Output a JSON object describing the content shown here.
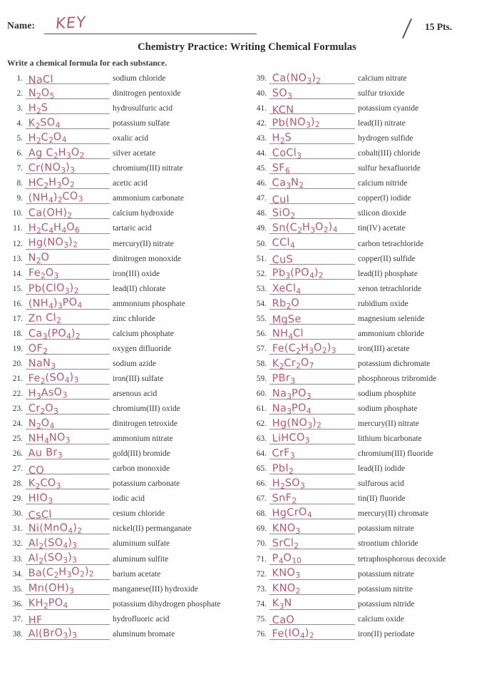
{
  "header": {
    "name_label": "Name:",
    "name_value": "KEY",
    "points": "15 Pts.",
    "score_mark": "slash-mark"
  },
  "title": "Chemistry Practice: Writing Chemical Formulas",
  "instruction": "Write a chemical formula for each substance.",
  "ink_color": "#c2566f",
  "text_color": "#3a3a3a",
  "items": [
    {
      "num": "1.",
      "formula": "NaCl",
      "name": "sodium chloride"
    },
    {
      "num": "2.",
      "formula": "N2O5",
      "name": "dinitrogen pentoxide"
    },
    {
      "num": "3.",
      "formula": "H2S",
      "name": "hydrosulfuric acid"
    },
    {
      "num": "4.",
      "formula": "K2SO4",
      "name": "potassium sulfate"
    },
    {
      "num": "5.",
      "formula": "H2C2O4",
      "name": "oxalic acid"
    },
    {
      "num": "6.",
      "formula": "Ag C2H3O2",
      "name": "silver acetate"
    },
    {
      "num": "7.",
      "formula": "Cr(NO3)3",
      "name": "chromium(III) nitrate"
    },
    {
      "num": "8.",
      "formula": "HC2H3O2",
      "name": "acetic acid"
    },
    {
      "num": "9.",
      "formula": "(NH4)2CO3",
      "name": "ammonium carbonate"
    },
    {
      "num": "10.",
      "formula": "Ca(OH)2",
      "name": "calcium hydroxide"
    },
    {
      "num": "11.",
      "formula": "H2C4H4O6",
      "name": "tartaric acid"
    },
    {
      "num": "12.",
      "formula": "Hg(NO3)2",
      "name": "mercury(II) nitrate"
    },
    {
      "num": "13.",
      "formula": "N2O",
      "name": "dinitrogen monoxide"
    },
    {
      "num": "14.",
      "formula": "Fe2O3",
      "name": "iron(III) oxide"
    },
    {
      "num": "15.",
      "formula": "Pb(ClO3)2",
      "name": "lead(II) chlorate"
    },
    {
      "num": "16.",
      "formula": "(NH4)3PO4",
      "name": "ammonium phosphate"
    },
    {
      "num": "17.",
      "formula": "Zn Cl2",
      "name": "zinc chloride"
    },
    {
      "num": "18.",
      "formula": "Ca3(PO4)2",
      "name": "calcium phosphate"
    },
    {
      "num": "19.",
      "formula": "OF2",
      "name": "oxygen difluoride"
    },
    {
      "num": "20.",
      "formula": "NaN3",
      "name": "sodium azide"
    },
    {
      "num": "21.",
      "formula": "Fe2(SO4)3",
      "name": "iron(III) sulfate"
    },
    {
      "num": "22.",
      "formula": "H3AsO3",
      "name": "arsenous acid"
    },
    {
      "num": "23.",
      "formula": "Cr2O3",
      "name": "chromium(III) oxide"
    },
    {
      "num": "24.",
      "formula": "N2O4",
      "name": "dinitrogen tetroxide"
    },
    {
      "num": "25.",
      "formula": "NH4NO3",
      "name": "ammonium nitrate"
    },
    {
      "num": "26.",
      "formula": "Au Br3",
      "name": "gold(III) bromide"
    },
    {
      "num": "27.",
      "formula": "CO",
      "name": "carbon monoxide"
    },
    {
      "num": "28.",
      "formula": "K2CO3",
      "name": "potassium carbonate"
    },
    {
      "num": "29.",
      "formula": "HIO3",
      "name": "iodic acid"
    },
    {
      "num": "30.",
      "formula": "CsCl",
      "name": "cesium chloride"
    },
    {
      "num": "31.",
      "formula": "Ni(MnO4)2",
      "name": "nickel(II) permanganate"
    },
    {
      "num": "32.",
      "formula": "Al2(SO4)3",
      "name": "aluminum sulfate"
    },
    {
      "num": "33.",
      "formula": "Al2(SO3)3",
      "name": "aluminum sulfite"
    },
    {
      "num": "34.",
      "formula": "Ba(C2H3O2)2",
      "name": "barium acetate"
    },
    {
      "num": "35.",
      "formula": "Mn(OH)3",
      "name": "manganese(III) hydroxide"
    },
    {
      "num": "36.",
      "formula": "KH2PO4",
      "name": "potassium dihydrogen phosphate"
    },
    {
      "num": "37.",
      "formula": "HF",
      "name": "hydrofluoric acid"
    },
    {
      "num": "38.",
      "formula": "Al(BrO3)3",
      "name": "aluminum bromate"
    },
    {
      "num": "39.",
      "formula": "Ca(NO3)2",
      "name": "calcium nitrate"
    },
    {
      "num": "40.",
      "formula": "SO3",
      "name": "sulfur trioxide"
    },
    {
      "num": "41.",
      "formula": "KCN",
      "name": "potassium cyanide"
    },
    {
      "num": "42.",
      "formula": "Pb(NO3)2",
      "name": "lead(II) nitrate"
    },
    {
      "num": "43.",
      "formula": "H2S",
      "name": "hydrogen sulfide"
    },
    {
      "num": "44.",
      "formula": "CoCl3",
      "name": "cobalt(III) chloride"
    },
    {
      "num": "45.",
      "formula": "SF6",
      "name": "sulfur hexafluoride"
    },
    {
      "num": "46.",
      "formula": "Ca3N2",
      "name": "calcium nitride"
    },
    {
      "num": "47.",
      "formula": "CuI",
      "name": "copper(I) iodide"
    },
    {
      "num": "48.",
      "formula": "SiO2",
      "name": "silicon dioxide"
    },
    {
      "num": "49.",
      "formula": "Sn(C2H3O2)4",
      "name": "tin(IV) acetate"
    },
    {
      "num": "50.",
      "formula": "CCl4",
      "name": "carbon tetrachloride"
    },
    {
      "num": "51.",
      "formula": "CuS",
      "name": "copper(II) sulfide"
    },
    {
      "num": "52.",
      "formula": "Pb3(PO4)2",
      "name": "lead(II) phosphate"
    },
    {
      "num": "53.",
      "formula": "XeCl4",
      "name": "xenon tetrachloride"
    },
    {
      "num": "54.",
      "formula": "Rb2O",
      "name": "rubidium oxide"
    },
    {
      "num": "55.",
      "formula": "MgSe",
      "name": "magnesium selenide"
    },
    {
      "num": "56.",
      "formula": "NH4Cl",
      "name": "ammonium chloride"
    },
    {
      "num": "57.",
      "formula": "Fe(C2H3O2)3",
      "name": "iron(III) acetate"
    },
    {
      "num": "58.",
      "formula": "K2Cr2O7",
      "name": "potassium dichromate"
    },
    {
      "num": "59.",
      "formula": "PBr3",
      "name": "phosphorous tribromide"
    },
    {
      "num": "60.",
      "formula": "Na3PO3",
      "name": "sodium phosphite"
    },
    {
      "num": "61.",
      "formula": "Na3PO4",
      "name": "sodium phosphate"
    },
    {
      "num": "62.",
      "formula": "Hg(NO3)2",
      "name": "mercury(II) nitrate"
    },
    {
      "num": "63.",
      "formula": "LiHCO3",
      "name": "lithium bicarbonate"
    },
    {
      "num": "64.",
      "formula": "CrF3",
      "name": "chromium(III) fluoride"
    },
    {
      "num": "65.",
      "formula": "PbI2",
      "name": "lead(II) iodide"
    },
    {
      "num": "66.",
      "formula": "H2SO3",
      "name": "sulfurous acid"
    },
    {
      "num": "67.",
      "formula": "SnF2",
      "name": "tin(II) fluoride"
    },
    {
      "num": "68.",
      "formula": "HgCrO4",
      "name": "mercury(II) chromate"
    },
    {
      "num": "69.",
      "formula": "KNO3",
      "name": "potassium nitrate"
    },
    {
      "num": "70.",
      "formula": "SrCl2",
      "name": "strontium chloride"
    },
    {
      "num": "71.",
      "formula": "P4O10",
      "name": "tetraphosphorous decoxide"
    },
    {
      "num": "72.",
      "formula": "KNO3",
      "name": "potassium nitrate"
    },
    {
      "num": "73.",
      "formula": "KNO2",
      "name": "potassium nitrite"
    },
    {
      "num": "74.",
      "formula": "K3N",
      "name": "potassium nitride"
    },
    {
      "num": "75.",
      "formula": "CaO",
      "name": "calcium oxide"
    },
    {
      "num": "76.",
      "formula": "Fe(IO4)2",
      "name": "iron(II) periodate"
    }
  ]
}
